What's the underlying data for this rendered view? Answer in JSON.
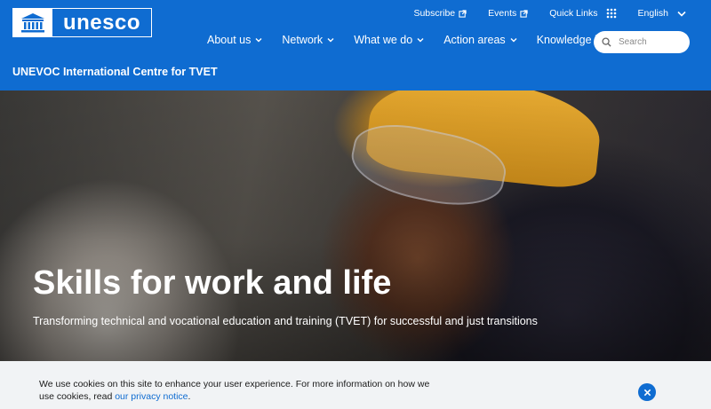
{
  "brand": {
    "logo_text": "unesco",
    "logo_icon": "unesco-temple-emblem",
    "primary_color": "#0f6cd1"
  },
  "utility_nav": {
    "subscribe": "Subscribe",
    "events": "Events",
    "quick_links": "Quick Links",
    "language": "English"
  },
  "main_nav": {
    "items": [
      {
        "label": "About us",
        "has_dropdown": true
      },
      {
        "label": "Network",
        "has_dropdown": true
      },
      {
        "label": "What we do",
        "has_dropdown": true
      },
      {
        "label": "Action areas",
        "has_dropdown": true
      },
      {
        "label": "Knowledge hub",
        "has_dropdown": false
      }
    ]
  },
  "search": {
    "placeholder": "Search",
    "value": ""
  },
  "site_title": "UNEVOC International Centre for TVET",
  "hero": {
    "title": "Skills for work and life",
    "subtitle": "Transforming technical and vocational education and training (TVET) for successful and just transitions"
  },
  "cookie_banner": {
    "text": "We use cookies on this site to enhance your user experience. For more information on how we use cookies, read ",
    "link_text": "our privacy notice",
    "suffix": ".",
    "close_icon": "close-icon"
  }
}
